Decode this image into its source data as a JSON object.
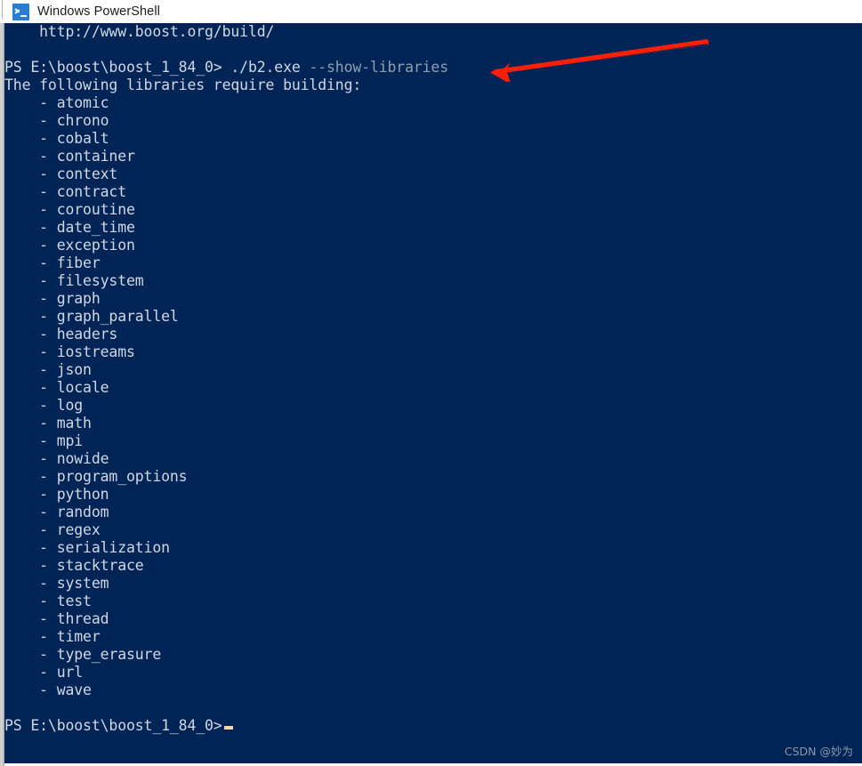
{
  "window": {
    "title": "Windows PowerShell",
    "icon": "powershell-icon",
    "title_bar_color": "#ffffff",
    "console_background": "#012456",
    "console_foreground": "#cfd8e3"
  },
  "console": {
    "partial_top_line": "    http://www.boost.org/build/",
    "blank_line": "",
    "prompt_command": {
      "prompt": "PS E:\\boost\\boost_1_84_0> ",
      "command": "./b2.exe ",
      "parameter": "--show-libraries",
      "parameter_color": "#8da0b0"
    },
    "message": "The following libraries require building:",
    "library_prefix": "    - ",
    "libraries": [
      "atomic",
      "chrono",
      "cobalt",
      "container",
      "context",
      "contract",
      "coroutine",
      "date_time",
      "exception",
      "fiber",
      "filesystem",
      "graph",
      "graph_parallel",
      "headers",
      "iostreams",
      "json",
      "locale",
      "log",
      "math",
      "mpi",
      "nowide",
      "program_options",
      "python",
      "random",
      "regex",
      "serialization",
      "stacktrace",
      "system",
      "test",
      "thread",
      "timer",
      "type_erasure",
      "url",
      "wave"
    ],
    "final_prompt": "PS E:\\boost\\boost_1_84_0>",
    "cursor": "_"
  },
  "annotation": {
    "arrow_name": "red-arrow-pointing-to-show-libraries",
    "color": "#fd2007",
    "direction": "left"
  },
  "watermark": {
    "text": "CSDN @妙为",
    "color": "#8b98a8"
  }
}
